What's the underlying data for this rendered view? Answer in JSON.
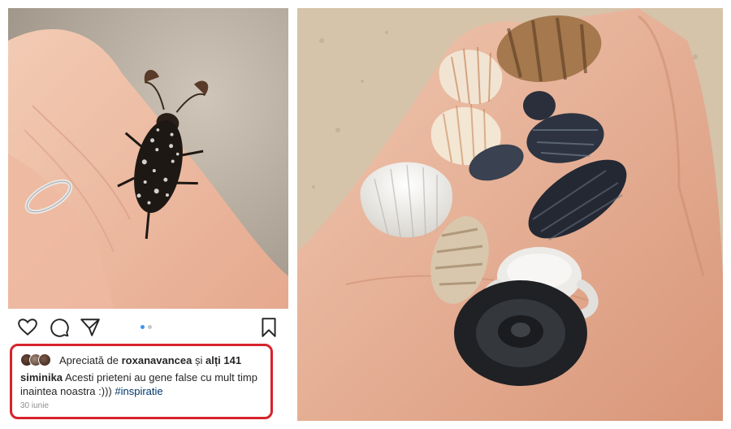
{
  "post": {
    "liked_prefix": "Apreciată de",
    "liked_user": "roxanavancea",
    "liked_and": "și",
    "liked_others": "alți 141",
    "username": "siminika",
    "caption": "Acesti prieteni au gene false cu mult timp inaintea noastra :)))",
    "hashtag": "#inspiratie",
    "date": "30 iunie"
  },
  "carousel": {
    "count": 2,
    "active": 1
  },
  "icons": {
    "like": "heart-icon",
    "comment": "comment-icon",
    "share": "paper-plane-icon",
    "save": "bookmark-icon"
  },
  "colors": {
    "highlight_border": "#d6232b",
    "active_dot": "#3897f0",
    "hashtag": "#003569",
    "muted": "#8e8e8e"
  }
}
